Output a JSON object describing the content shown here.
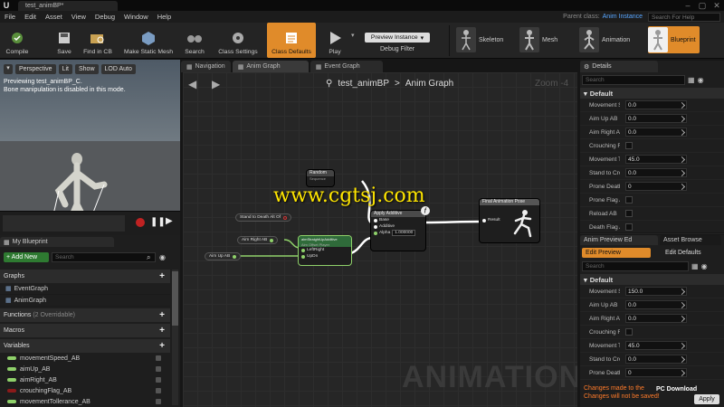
{
  "window": {
    "doc_tab": "test_animBP*",
    "logo": "U"
  },
  "menu": [
    "File",
    "Edit",
    "Asset",
    "View",
    "Debug",
    "Window",
    "Help"
  ],
  "parent_class": {
    "label": "Parent class:",
    "value": "Anim Instance"
  },
  "help_search": {
    "placeholder": "Search For Help"
  },
  "toolbar": {
    "buttons": [
      "Compile",
      "Save",
      "Find in CB",
      "Make Static Mesh",
      "Search",
      "Class Settings",
      "Class Defaults",
      "Play"
    ],
    "preview_instance": "Preview Instance",
    "debug_filter": "Debug Filter",
    "modes": [
      "Skeleton",
      "Mesh",
      "Animation",
      "Blueprint"
    ]
  },
  "viewport": {
    "buttons": [
      "Perspective",
      "Lit",
      "Show",
      "LOD Auto"
    ],
    "preview_text": "Previewing test_animBP_C.",
    "bone_text": "Bone manipulation is disabled in this mode."
  },
  "graph_tabs": [
    "Navigation",
    "Anim Graph",
    "Event Graph"
  ],
  "graph": {
    "breadcrumb_bp": "test_animBP",
    "breadcrumb_sep": ">",
    "breadcrumb_graph": "Anim Graph",
    "zoom": "Zoom -4",
    "watermark_url": "www.cgtsj.com",
    "bottom_text": "ANIMATION",
    "nodes": {
      "random": {
        "title": "Random",
        "sub": "Sequence"
      },
      "apply_additive": {
        "title": "Apply Additive",
        "pins": [
          "Base",
          "Additive"
        ],
        "alpha_label": "Alpha",
        "alpha_value": "1.000000"
      },
      "final": {
        "title": "Final Animation Pose",
        "pin": "Result"
      },
      "aim_offset": {
        "title": "aimStraightUpAdditive",
        "sub": "Aim Offset Player",
        "pins": [
          "LeftRight",
          "UpDn"
        ]
      },
      "dead": "Stand to Death Alt Of",
      "aim_right": "Aim Right AB",
      "aim_up": "Aim Up AB"
    }
  },
  "my_blueprint": {
    "title": "My Blueprint",
    "add_new": "+ Add New",
    "search_placeholder": "Search",
    "graphs_label": "Graphs",
    "graphs": [
      "EventGraph",
      "AnimGraph"
    ],
    "functions_label": "Functions",
    "functions_count": "(2 Overridable)",
    "macros_label": "Macros",
    "variables_label": "Variables",
    "variables": [
      "movementSpeed_AB",
      "aimUp_AB",
      "aimRight_AB",
      "crouchingFlag_AB",
      "movementTollerance_AB"
    ]
  },
  "details": {
    "title": "Details",
    "search_placeholder": "Search",
    "section": "Default",
    "rows": [
      {
        "label": "Movement S",
        "value": "0.0",
        "type": "num"
      },
      {
        "label": "Aim Up AB",
        "value": "0.0",
        "type": "num"
      },
      {
        "label": "Aim Right AE",
        "value": "0.0",
        "type": "num"
      },
      {
        "label": "Crouching Fl",
        "value": "",
        "type": "check"
      },
      {
        "label": "Movement T",
        "value": "45.0",
        "type": "num"
      },
      {
        "label": "Stand to Cro",
        "value": "0.0",
        "type": "num"
      },
      {
        "label": "Prone Death",
        "value": "0",
        "type": "num"
      },
      {
        "label": "Prone Flag A",
        "value": "",
        "type": "check"
      },
      {
        "label": "Reload AB",
        "value": "",
        "type": "check"
      },
      {
        "label": "Death Flag A",
        "value": "",
        "type": "check"
      }
    ]
  },
  "anim_preview": {
    "tabs": [
      "Anim Preview Ed",
      "Asset Browse"
    ],
    "edit_preview": "Edit Preview",
    "edit_defaults": "Edit Defaults",
    "search_placeholder": "Search",
    "section": "Default",
    "rows": [
      {
        "label": "Movement S",
        "value": "150.0",
        "type": "num"
      },
      {
        "label": "Aim Up AB",
        "value": "0.0",
        "type": "num"
      },
      {
        "label": "Aim Right Al",
        "value": "0.0",
        "type": "num"
      },
      {
        "label": "Crouching Fl",
        "value": "",
        "type": "check"
      },
      {
        "label": "Movement T",
        "value": "45.0",
        "type": "num"
      },
      {
        "label": "Stand to Cro",
        "value": "0.0",
        "type": "num"
      },
      {
        "label": "Prone Death",
        "value": "0",
        "type": "num"
      }
    ],
    "changes1": "Changes made to the",
    "changes2": "Changes will not be saved!",
    "apply": "Apply",
    "pc_logo": "PC Download"
  },
  "colors": {
    "accent": "#e08b2a",
    "link": "#58a6ff",
    "watermark": "#ffe600",
    "warning": "#ff7b2a"
  }
}
